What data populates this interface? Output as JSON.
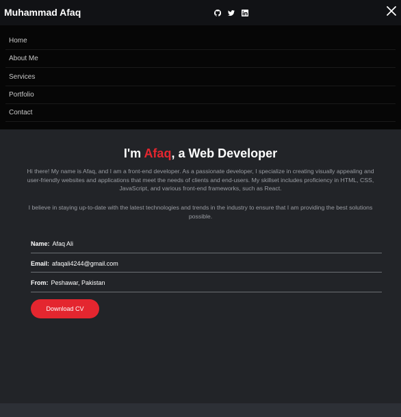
{
  "header": {
    "brand": "Muhammad Afaq",
    "social_icons": [
      "github-icon",
      "twitter-icon",
      "linkedin-icon"
    ],
    "close_icon": "close-icon"
  },
  "menu": {
    "items": [
      {
        "label": "Home"
      },
      {
        "label": "About Me"
      },
      {
        "label": "Services"
      },
      {
        "label": "Portfolio"
      },
      {
        "label": "Contact"
      }
    ]
  },
  "about": {
    "headline_prefix": "I'm ",
    "headline_name": "Afaq",
    "headline_suffix": ", a Web Developer",
    "intro": "Hi there! My name is Afaq, and I am a front-end developer. As a passionate developer, I specialize in creating visually appealing and user-friendly websites and applications that meet the needs of clients and end-users. My skillset includes proficiency in HTML, CSS, JavaScript, and various front-end frameworks, such as React.",
    "intro2": "I believe in staying up-to-date with the latest technologies and trends in the industry to ensure that I am providing the best solutions possible.",
    "info": [
      {
        "key": "Name:",
        "value": "Afaq Ali"
      },
      {
        "key": "Email:",
        "value": "afaqali4244@gmail.com"
      },
      {
        "key": "From:",
        "value": "Peshawar, Pakistan"
      }
    ],
    "cv_button": "Download CV"
  },
  "colors": {
    "accent": "#e4262f",
    "header_bg": "#111215",
    "menu_bg": "#060606",
    "main_bg": "#222428"
  }
}
